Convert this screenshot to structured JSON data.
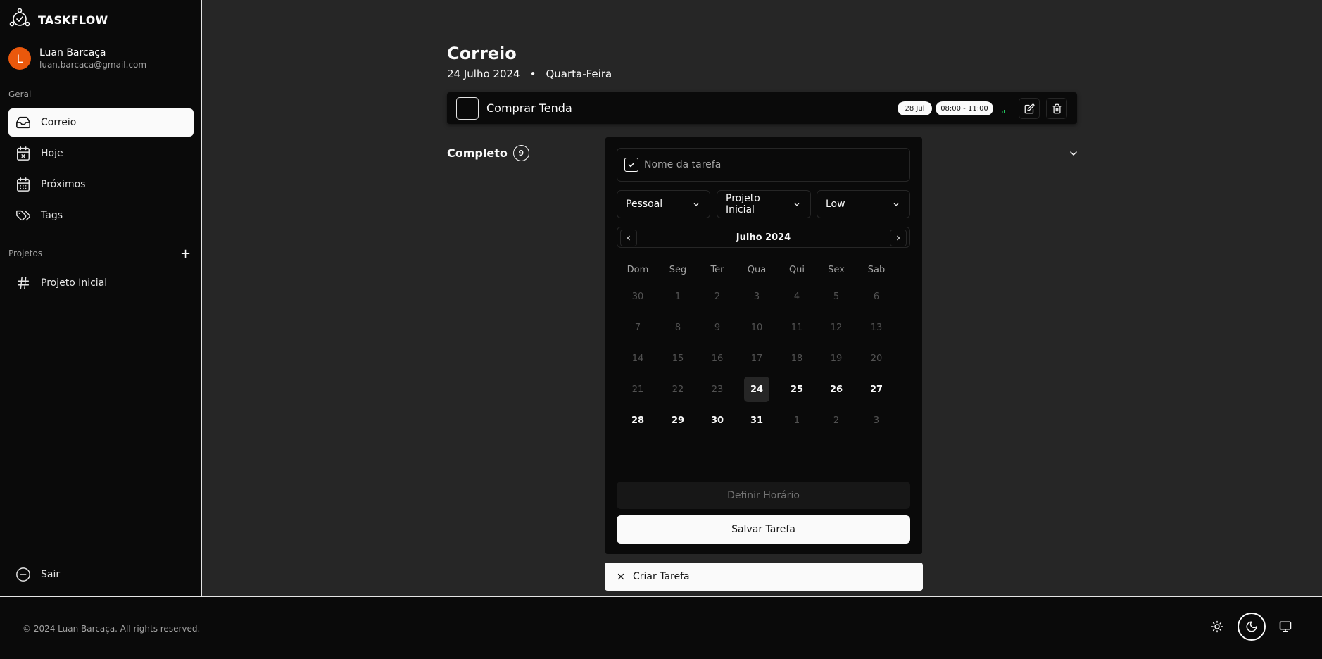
{
  "app": {
    "name": "TASKFLOW"
  },
  "user": {
    "initial": "L",
    "name": "Luan Barcaça",
    "email": "luan.barcaca@gmail.com"
  },
  "sidebar": {
    "general_label": "Geral",
    "items": [
      {
        "label": "Correio",
        "icon": "inbox-icon",
        "active": true
      },
      {
        "label": "Hoje",
        "icon": "calendar-x-icon"
      },
      {
        "label": "Próximos",
        "icon": "calendar-days-icon"
      },
      {
        "label": "Tags",
        "icon": "tags-icon"
      }
    ],
    "projects_label": "Projetos",
    "add_project_symbol": "+",
    "projects": [
      {
        "label": "Projeto Inicial",
        "icon": "hash-icon"
      }
    ],
    "logout_label": "Sair"
  },
  "page": {
    "title": "Correio",
    "date": "24 Julho 2024",
    "separator": "•",
    "weekday": "Quarta-Feira"
  },
  "task": {
    "name": "Comprar Tenda",
    "date_badge": "28 Jul",
    "time_badge": "08:00 - 11:00",
    "priority_color": "#22c55e"
  },
  "completed": {
    "label": "Completo",
    "count": "9"
  },
  "form": {
    "task_name_placeholder": "Nome da tarefa",
    "category": "Pessoal",
    "project": "Projeto Inicial",
    "priority": "Low",
    "calendar": {
      "month_title": "Julho 2024",
      "weekdays": [
        "Dom",
        "Seg",
        "Ter",
        "Qua",
        "Qui",
        "Sex",
        "Sab"
      ],
      "weeks": [
        [
          "30",
          "1",
          "2",
          "3",
          "4",
          "5",
          "6"
        ],
        [
          "7",
          "8",
          "9",
          "10",
          "11",
          "12",
          "13"
        ],
        [
          "14",
          "15",
          "16",
          "17",
          "18",
          "19",
          "20"
        ],
        [
          "21",
          "22",
          "23",
          "24",
          "25",
          "26",
          "27"
        ],
        [
          "28",
          "29",
          "30",
          "31",
          "1",
          "2",
          "3"
        ]
      ],
      "selected_day": "24"
    },
    "define_time_label": "Definir Horário",
    "save_label": "Salvar Tarefa"
  },
  "create_task_label": "Criar Tarefa",
  "footer": {
    "copyright": "© 2024 Luan Barcaça. All rights reserved.",
    "theme_options": [
      "sun-icon",
      "moon-icon",
      "monitor-icon"
    ],
    "active_theme": "moon-icon"
  },
  "colors": {
    "accent": "#ea580c",
    "background": "#262626",
    "panel": "#0a0a0a"
  }
}
